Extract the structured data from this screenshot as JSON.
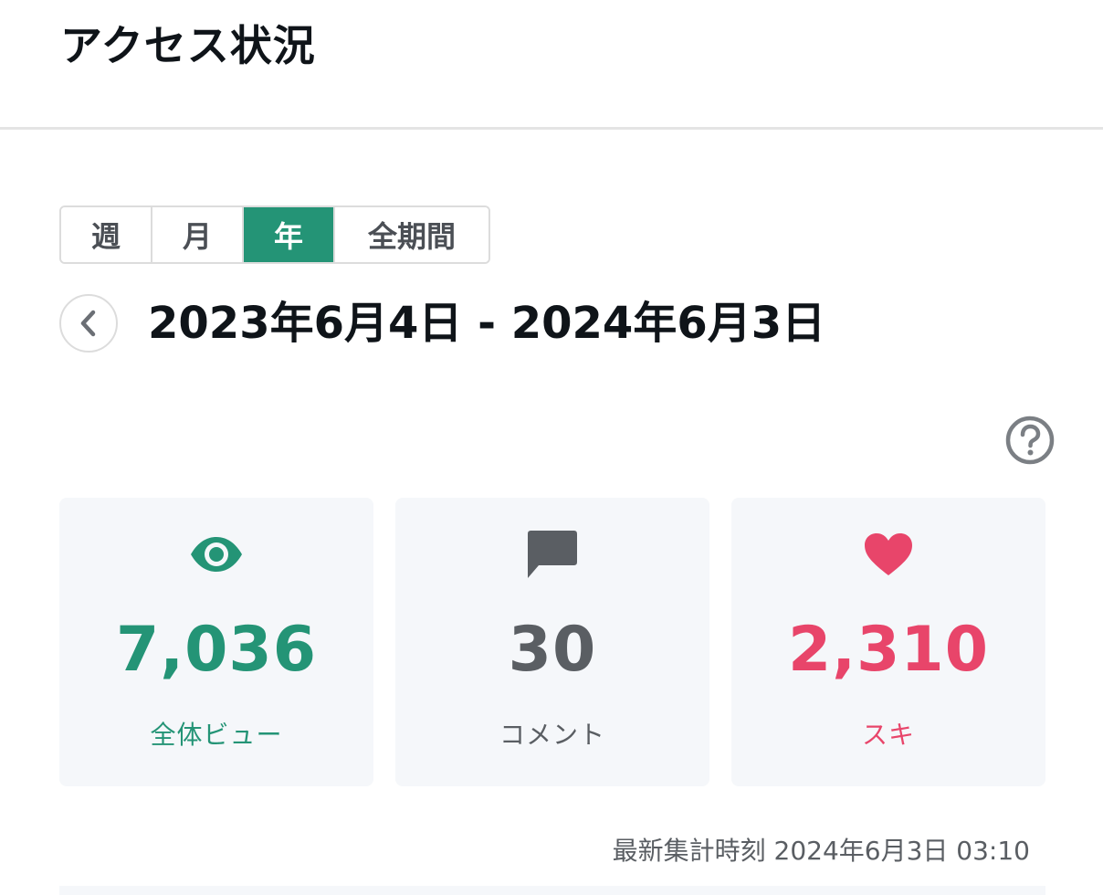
{
  "page": {
    "title": "アクセス状況"
  },
  "period_tabs": [
    {
      "label": "週",
      "active": false
    },
    {
      "label": "月",
      "active": false
    },
    {
      "label": "年",
      "active": true
    },
    {
      "label": "全期間",
      "active": false
    }
  ],
  "date_range": {
    "text": "2023年6月4日 - 2024年6月3日"
  },
  "icons": {
    "prev": "chevron-left-icon",
    "help": "question-circle-icon",
    "views": "eye-icon",
    "comments": "comment-icon",
    "likes": "heart-icon"
  },
  "stats": {
    "views": {
      "value": "7,036",
      "label": "全体ビュー",
      "color": "#249476"
    },
    "comments": {
      "value": "30",
      "label": "コメント",
      "color": "#5a5e63"
    },
    "likes": {
      "value": "2,310",
      "label": "スキ",
      "color": "#e8456a"
    }
  },
  "updated_at": "最新集計時刻 2024年6月3日 03:10",
  "colors": {
    "accent": "#249476",
    "like": "#e8456a",
    "muted": "#5a5e63",
    "card_bg": "#f5f7fa"
  }
}
